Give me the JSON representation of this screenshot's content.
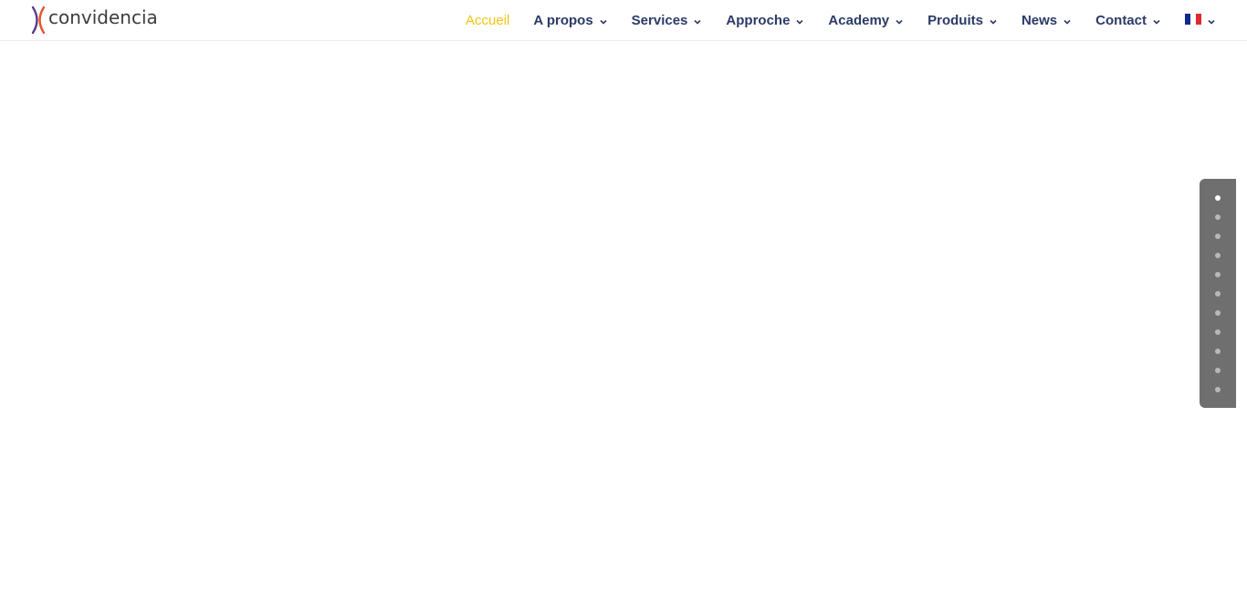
{
  "logo": {
    "text": "convidencia"
  },
  "nav": {
    "items": [
      {
        "label": "Accueil",
        "active": true,
        "has_dropdown": false
      },
      {
        "label": "A propos",
        "active": false,
        "has_dropdown": true
      },
      {
        "label": "Services",
        "active": false,
        "has_dropdown": true
      },
      {
        "label": "Approche",
        "active": false,
        "has_dropdown": true
      },
      {
        "label": "Academy",
        "active": false,
        "has_dropdown": true
      },
      {
        "label": "Produits",
        "active": false,
        "has_dropdown": true
      },
      {
        "label": "News",
        "active": false,
        "has_dropdown": true
      },
      {
        "label": "Contact",
        "active": false,
        "has_dropdown": true
      }
    ],
    "language": {
      "icon": "french-flag-icon",
      "has_dropdown": true
    }
  },
  "colors": {
    "nav_text": "#2b3a67",
    "active": "#f1c40f",
    "logo_text": "#3d3d3d",
    "dots_panel": "#6f6f6f"
  },
  "section_dots": {
    "count": 11,
    "active_index": 0
  }
}
